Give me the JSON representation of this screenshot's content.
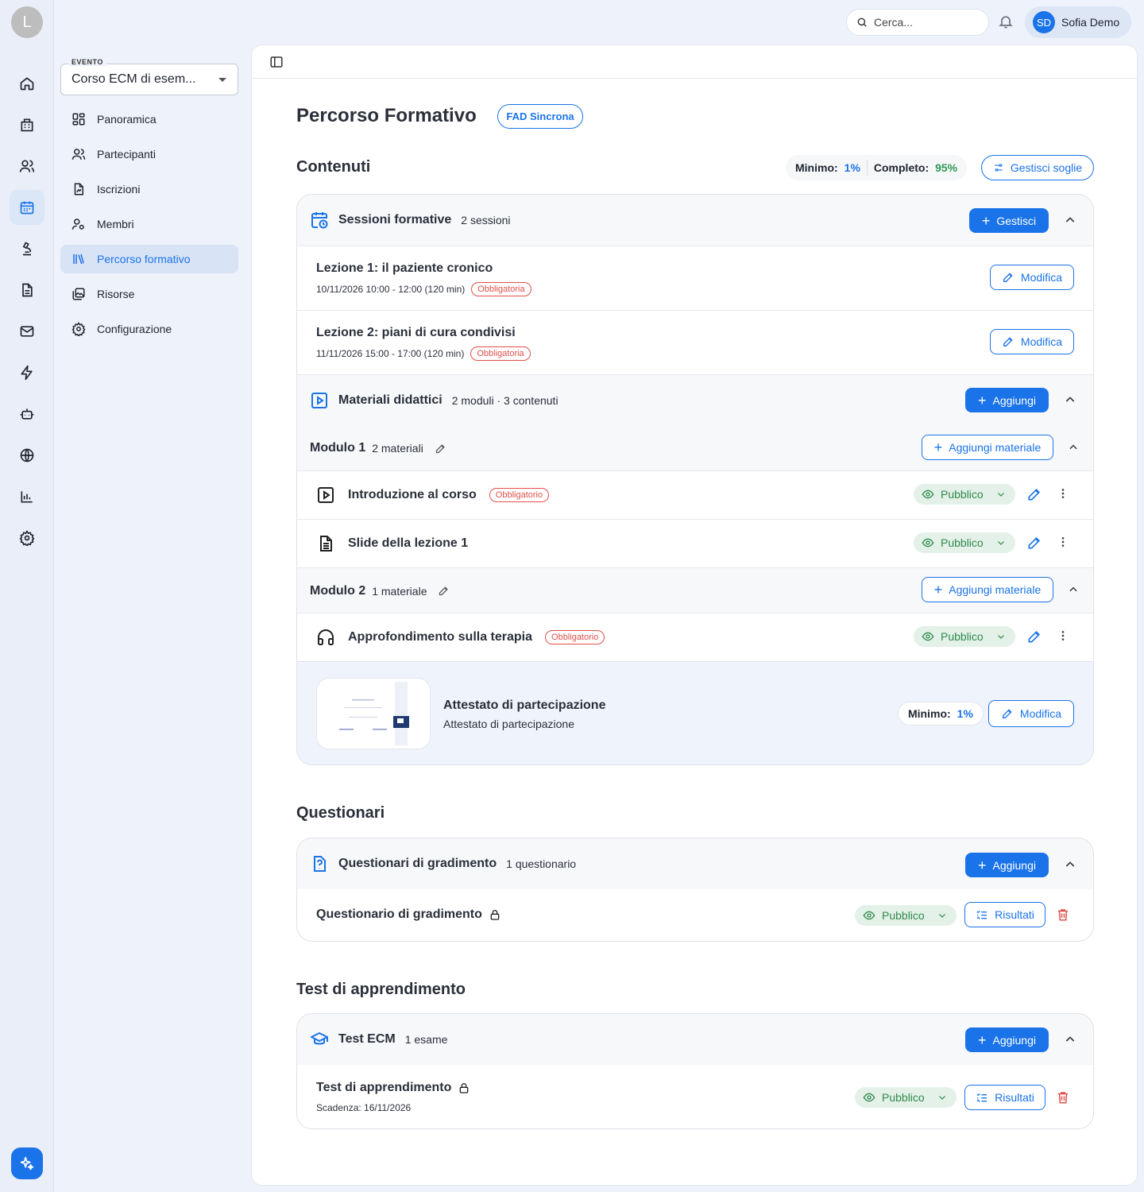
{
  "rail": {
    "avatar_initial": "L"
  },
  "topbar": {
    "search_placeholder": "Cerca...",
    "user_initials": "SD",
    "user_name": "Sofia Demo"
  },
  "sidebar": {
    "event_label": "EVENTO",
    "event_value": "Corso ECM di esem...",
    "items": [
      {
        "label": "Panoramica",
        "icon": "grid-icon"
      },
      {
        "label": "Partecipanti",
        "icon": "users-icon"
      },
      {
        "label": "Iscrizioni",
        "icon": "file-signature-icon"
      },
      {
        "label": "Membri",
        "icon": "user-key-icon"
      },
      {
        "label": "Percorso formativo",
        "icon": "library-icon",
        "active": true
      },
      {
        "label": "Risorse",
        "icon": "images-icon"
      },
      {
        "label": "Configurazione",
        "icon": "gear-icon"
      }
    ]
  },
  "page": {
    "title": "Percorso Formativo",
    "badge": "FAD Sincrona"
  },
  "contenuti": {
    "title": "Contenuti",
    "min_label": "Minimo:",
    "min_value": "1%",
    "complete_label": "Completo:",
    "complete_value": "95%",
    "manage_button": "Gestisci soglie",
    "sessions": {
      "title": "Sessioni formative",
      "count": "2 sessioni",
      "button": "Gestisci",
      "items": [
        {
          "title": "Lezione 1: il paziente cronico",
          "when": "10/11/2026 10:00 - 12:00 (120 min)",
          "tag": "Obbligatoria",
          "button": "Modifica"
        },
        {
          "title": "Lezione 2: piani di cura condivisi",
          "when": "11/11/2026 15:00 - 17:00 (120 min)",
          "tag": "Obbligatoria",
          "button": "Modifica"
        }
      ]
    },
    "materials": {
      "title": "Materiali didattici",
      "count": "2 moduli · 3 contenuti",
      "button": "Aggiungi",
      "modules": [
        {
          "title": "Modulo 1",
          "count": "2 materiali",
          "button": "Aggiungi materiale",
          "items": [
            {
              "title": "Introduzione al corso",
              "tag": "Obbligatorio",
              "icon": "video-icon",
              "visibility": "Pubblico"
            },
            {
              "title": "Slide della lezione 1",
              "tag": "",
              "icon": "document-icon",
              "visibility": "Pubblico"
            }
          ]
        },
        {
          "title": "Modulo 2",
          "count": "1 materiale",
          "button": "Aggiungi materiale",
          "items": [
            {
              "title": "Approfondimento sulla terapia",
              "tag": "Obbligatorio",
              "icon": "headphones-icon",
              "visibility": "Pubblico"
            }
          ]
        }
      ]
    },
    "certificate": {
      "title": "Attestato di partecipazione",
      "subtitle": "Attestato di partecipazione",
      "min_label": "Minimo:",
      "min_value": "1%",
      "button": "Modifica"
    }
  },
  "questionari": {
    "title": "Questionari",
    "group": {
      "title": "Questionari di gradimento",
      "count": "1 questionario",
      "button": "Aggiungi"
    },
    "item": {
      "title": "Questionario di gradimento",
      "visibility": "Pubblico",
      "results": "Risultati"
    }
  },
  "test": {
    "title": "Test di apprendimento",
    "group": {
      "title": "Test ECM",
      "count": "1 esame",
      "button": "Aggiungi"
    },
    "item": {
      "title": "Test di apprendimento",
      "deadline": "Scadenza: 16/11/2026",
      "visibility": "Pubblico",
      "results": "Risultati"
    }
  },
  "colors": {
    "accent": "#1a73e8",
    "success": "#2e9a54",
    "danger": "#e0504a",
    "sidebar_active": "#d8e3f6"
  }
}
